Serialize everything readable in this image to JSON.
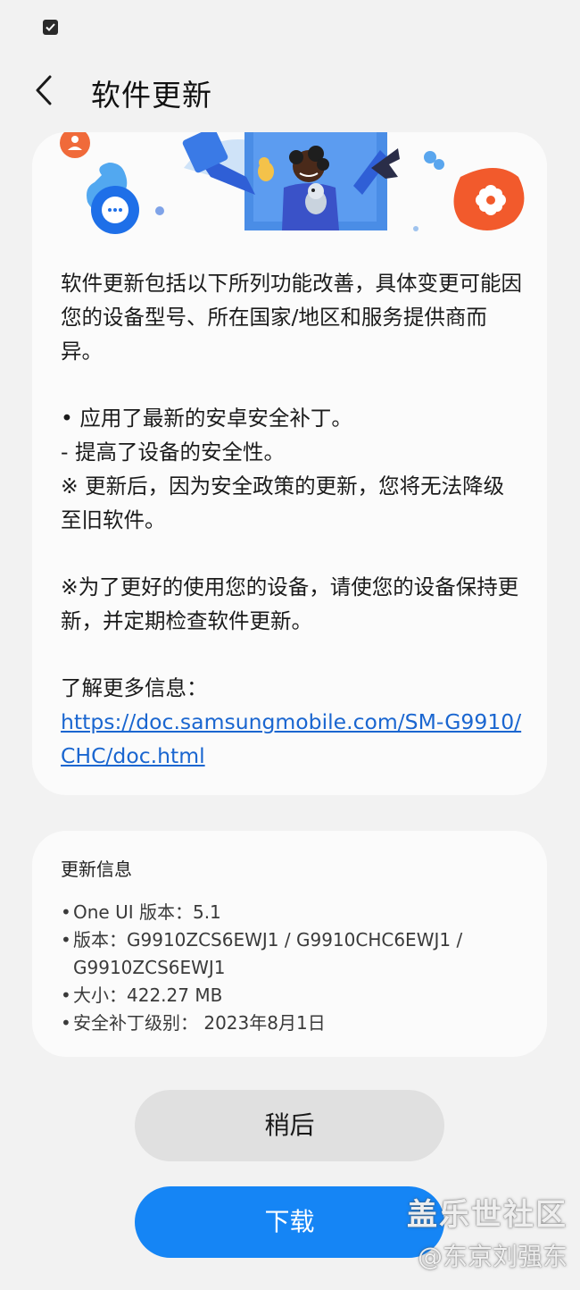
{
  "app": {
    "title": "软件更新"
  },
  "release_notes": {
    "paragraphs": [
      "软件更新包括以下所列功能改善，具体变更可能因您的设备型号、所在国家/地区和服务提供商而异。",
      "• 应用了最新的安卓安全补丁。",
      " - 提高了设备的安全性。",
      "※ 更新后，因为安全政策的更新，您将无法降级至旧软件。",
      "※为了更好的使用您的设备，请使您的设备保持更新，并定期检查软件更新。",
      "了解更多信息："
    ],
    "link": "https://doc.samsungmobile.com/SM-G9910/CHC/doc.html"
  },
  "update_info": {
    "heading": "更新信息",
    "bullet": "•",
    "items": [
      "One UI 版本：5.1",
      "版本：G9910ZCS6EWJ1 / G9910CHC6EWJ1 / G9910ZCS6EWJ1",
      "大小：422.27 MB",
      "安全补丁级别： 2023年8月1日"
    ]
  },
  "buttons": {
    "later": "稍后",
    "download": "下载"
  },
  "watermark": {
    "line1": "盖乐世社区",
    "line2": "@东京刘强东"
  },
  "colors": {
    "accent": "#1585f5",
    "link": "#1a66d0",
    "card": "#fbfbfb",
    "background": "#f2f2f2"
  }
}
